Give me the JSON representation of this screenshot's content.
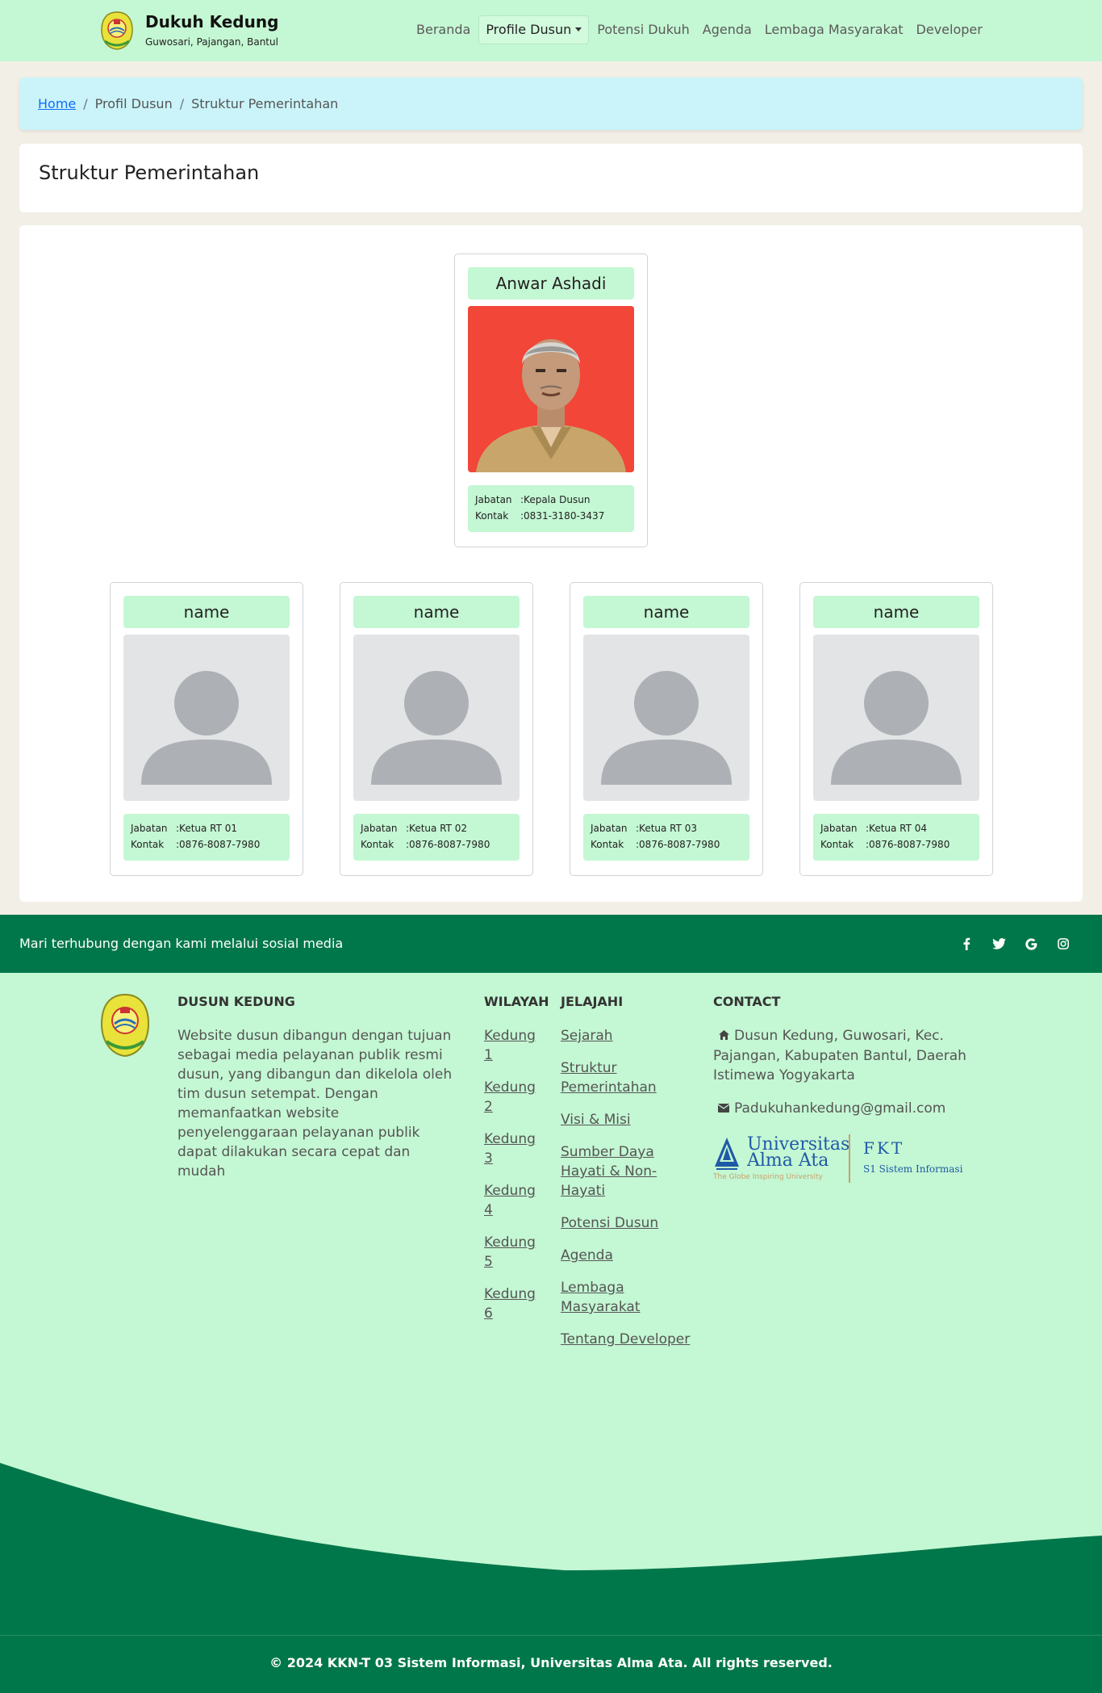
{
  "navbar": {
    "brand_title": "Dukuh Kedung",
    "brand_subtitle": "Guwosari, Pajangan, Bantul",
    "links": {
      "home": "Beranda",
      "profile": "Profile Dusun",
      "potensi": "Potensi Dukuh",
      "agenda": "Agenda",
      "lembaga": "Lembaga Masyarakat",
      "developer": "Developer"
    }
  },
  "breadcrumb": {
    "home": "Home",
    "level1": "Profil Dusun",
    "current": "Struktur Pemerintahan"
  },
  "page_title": "Struktur Pemerintahan",
  "labels": {
    "jabatan": "Jabatan",
    "kontak": "Kontak"
  },
  "head": {
    "name": "Anwar Ashadi",
    "jabatan": "Kepala Dusun",
    "kontak": "0831-3180-3437"
  },
  "members": [
    {
      "name": "name",
      "jabatan": "Ketua RT 01",
      "kontak": "0876-8087-7980"
    },
    {
      "name": "name",
      "jabatan": "Ketua RT 02",
      "kontak": "0876-8087-7980"
    },
    {
      "name": "name",
      "jabatan": "Ketua RT 03",
      "kontak": "0876-8087-7980"
    },
    {
      "name": "name",
      "jabatan": "Ketua RT 04",
      "kontak": "0876-8087-7980"
    }
  ],
  "social": {
    "text": "Mari terhubung dengan kami melalui sosial media",
    "icons": [
      "facebook-icon",
      "twitter-icon",
      "google-icon",
      "instagram-icon"
    ]
  },
  "footer": {
    "about_heading": "DUSUN KEDUNG",
    "about_text": "Website dusun dibangun dengan tujuan sebagai media pelayanan publik resmi dusun, yang dibangun dan dikelola oleh tim dusun setempat. Dengan memanfaatkan website penyelenggaraan pelayanan publik dapat dilakukan secara cepat dan mudah",
    "wilayah_heading": "WILAYAH",
    "wilayah": [
      "Kedung 1",
      "Kedung 2",
      "Kedung 3",
      "Kedung 4",
      "Kedung 5",
      "Kedung 6"
    ],
    "jelajahi_heading": "JELAJAHI",
    "jelajahi": [
      "Sejarah",
      "Struktur Pemerintahan",
      "Visi & Misi",
      "Sumber Daya Hayati & Non-Hayati",
      "Potensi Dusun",
      "Agenda",
      "Lembaga Masyarakat",
      "Tentang Developer"
    ],
    "contact_heading": "CONTACT",
    "address": "Dusun Kedung, Guwosari, Kec. Pajangan, Kabupaten Bantul, Daerah Istimewa Yogyakarta",
    "email": "Padukuhankedung@gmail.com",
    "uni_name_1": "Universitas",
    "uni_name_2": "Alma Ata",
    "uni_tagline": "The Globe Inspiring University",
    "fkt": "FKT",
    "prodi": "S1 Sistem Informasi"
  },
  "copyright": "© 2024 KKN-T 03 Sistem Informasi, Universitas Alma Ata. All rights reserved.",
  "colors": {
    "nav_bg": "#c4f7d3",
    "footer_dark": "#00774a",
    "breadcrumb_bg": "#caf4f9",
    "page_bg": "#f2efe6"
  }
}
